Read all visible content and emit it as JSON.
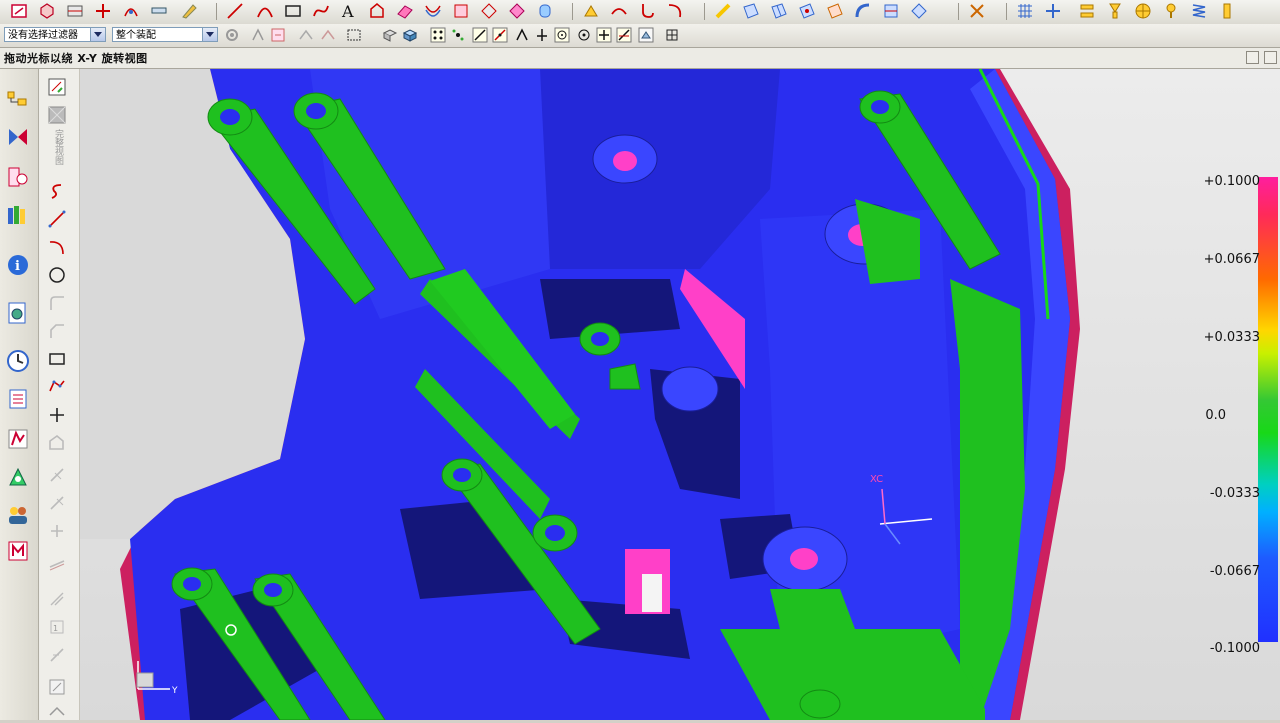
{
  "filters": {
    "type_filter": "没有选择过滤器",
    "scope": "整个装配"
  },
  "status": {
    "prompt": "拖动光标以绕 X-Y 旋转视图"
  },
  "palette": {
    "vertical_label": "完整视图"
  },
  "viewport": {
    "csys_label": "XC",
    "wcs_axis_label": "Y"
  },
  "colorbar": {
    "labels": [
      "+0.1000",
      "+0.0667",
      "+0.0333",
      "0.0",
      "-0.0333",
      "-0.0667",
      "-0.1000"
    ],
    "values": [
      0.1,
      0.0667,
      0.0333,
      0.0,
      -0.0333,
      -0.0667,
      -0.1
    ],
    "colors": {
      "top": "#ff1e9e",
      "middle": "#18d818",
      "bottom": "#2030ff"
    }
  },
  "model_colors": {
    "body": "#2a2ef0",
    "shadow": "#14167a",
    "green": "#1fc01f",
    "pink": "#ff40c8"
  }
}
